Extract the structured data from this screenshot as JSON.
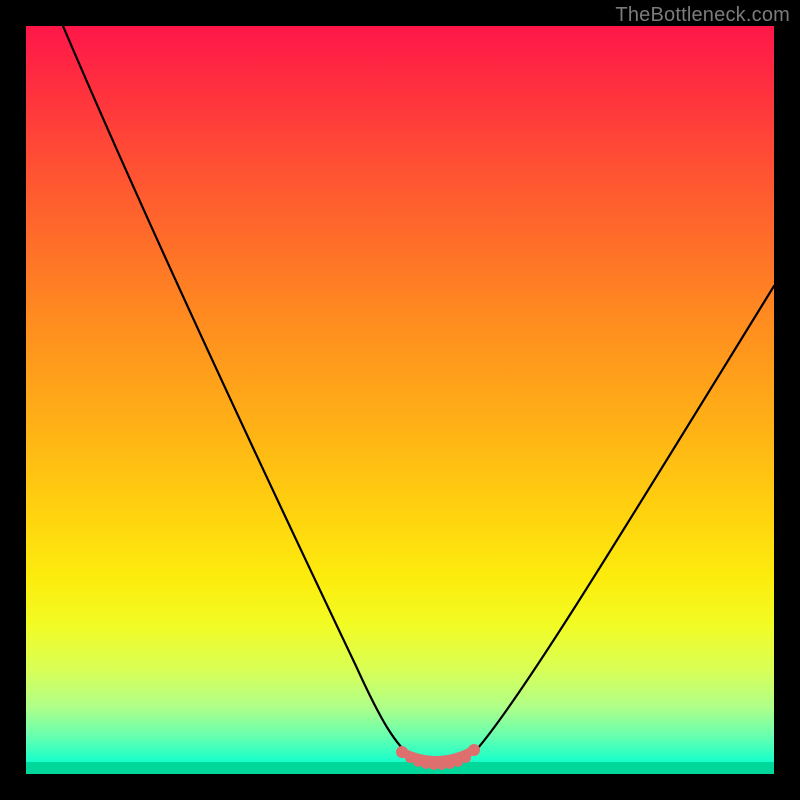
{
  "watermark": "TheBottleneck.com",
  "chart_data": {
    "type": "line",
    "title": "",
    "xlabel": "",
    "ylabel": "",
    "xlim": [
      0,
      100
    ],
    "ylim": [
      0,
      100
    ],
    "grid": false,
    "legend": false,
    "background_gradient": {
      "top": "#ff1649",
      "bottom": "#00d89b",
      "description": "red-orange-yellow-green vertical gradient"
    },
    "series": [
      {
        "name": "bottleneck-curve",
        "color": "#000000",
        "x": [
          5,
          10,
          15,
          20,
          25,
          30,
          35,
          40,
          45,
          48,
          50,
          52,
          54,
          56,
          58,
          60,
          65,
          70,
          75,
          80,
          85,
          90,
          95,
          100
        ],
        "y": [
          100,
          90,
          80,
          69,
          58,
          47,
          36,
          25,
          13,
          6,
          3,
          1,
          0,
          0,
          0,
          1,
          5,
          12,
          20,
          29,
          38,
          48,
          58,
          68
        ]
      },
      {
        "name": "optimum-marker",
        "color": "#e46a6a",
        "style": "thick-dots",
        "x": [
          50,
          51,
          52,
          53,
          54,
          55,
          56,
          57,
          58,
          59
        ],
        "y": [
          2,
          1.2,
          0.7,
          0.4,
          0.3,
          0.3,
          0.4,
          0.6,
          1.0,
          1.8
        ]
      }
    ],
    "annotations": []
  }
}
